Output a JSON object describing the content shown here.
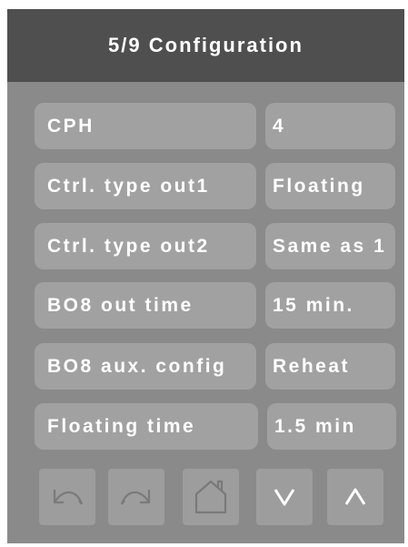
{
  "header": {
    "title": "5/9 Configuration"
  },
  "rows": [
    {
      "label": "CPH",
      "value": "4"
    },
    {
      "label": "Ctrl. type out1",
      "value": "Floating"
    },
    {
      "label": "Ctrl. type out2",
      "value": "Same as 1"
    },
    {
      "label": "BO8 out time",
      "value": "15 min."
    },
    {
      "label": "BO8 aux. config",
      "value": "Reheat"
    },
    {
      "label": "Floating time",
      "value": "1.5 min"
    }
  ],
  "nav": {
    "buttons": [
      {
        "icon": "undo-icon"
      },
      {
        "icon": "redo-icon"
      },
      {
        "icon": "home-icon"
      },
      {
        "icon": "chevron-down-icon"
      },
      {
        "icon": "chevron-up-icon"
      }
    ]
  },
  "colors": {
    "header_bg": "#4f4f4f",
    "panel_bg": "#8a8a8a",
    "field_bg": "#a1a1a1",
    "text": "#ffffff",
    "icon_stroke": "#7a7a7a"
  }
}
